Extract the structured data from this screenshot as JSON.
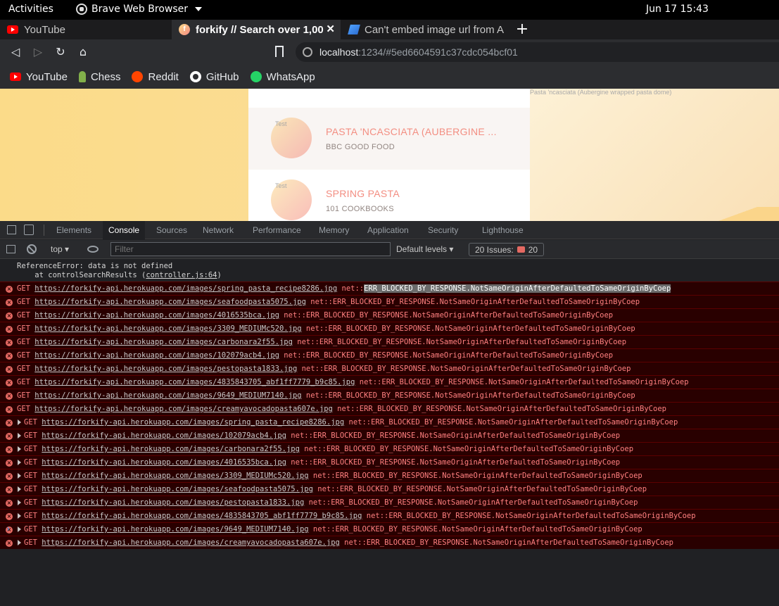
{
  "topbar": {
    "activities": "Activities",
    "app_name": "Brave Web Browser",
    "clock": "Jun 17  15:43"
  },
  "tabs": [
    {
      "title": "YouTube",
      "icon": "youtube-icon"
    },
    {
      "title": "forkify // Search over 1,00",
      "icon": "forkify-icon"
    },
    {
      "title": "Can't embed image url from A",
      "icon": "codesandbox-icon"
    }
  ],
  "toolbar": {
    "url_host": "localhost",
    "url_rest": ":1234/#5ed6604591c37cdc054bcf01"
  },
  "bookmarks": [
    {
      "label": "YouTube",
      "icon": "youtube-icon"
    },
    {
      "label": "Chess",
      "icon": "chess-icon"
    },
    {
      "label": "Reddit",
      "icon": "reddit-icon"
    },
    {
      "label": "GitHub",
      "icon": "github-icon"
    },
    {
      "label": "WhatsApp",
      "icon": "whatsapp-icon"
    }
  ],
  "page": {
    "recipe_image_alt": "Pasta 'ncasciata (Aubergine wrapped pasta dome)",
    "results": [
      {
        "title": "PASTA 'NCASCIATA (AUBERGINE ...",
        "publisher": "BBC GOOD FOOD",
        "img_alt": "Test",
        "active": true
      },
      {
        "title": "SPRING PASTA",
        "publisher": "101 COOKBOOKS",
        "img_alt": "Test",
        "active": false
      }
    ]
  },
  "devtools": {
    "tabs": [
      "Elements",
      "Console",
      "Sources",
      "Network",
      "Performance",
      "Memory",
      "Application",
      "Security",
      "Lighthouse"
    ],
    "active_tab": "Console",
    "context": "top",
    "filter_placeholder": "Filter",
    "levels": "Default levels",
    "issues_label": "20 Issues:",
    "issues_count": "20",
    "ref_error_line1": "ReferenceError: data is not defined",
    "ref_error_line2_prefix": "    at controlSearchResults (",
    "ref_error_link": "controller.js:64",
    "ref_error_line2_suffix": ")",
    "colors": {
      "error_bg": "#290000",
      "error_text": "#ff8080",
      "error_border": "#5c0000"
    },
    "error_suffix": "net::ERR_BLOCKED_BY_RESPONSE.NotSameOriginAfterDefaultedToSameOriginByCoep",
    "errors": [
      {
        "url": "https://forkify-api.herokuapp.com/images/spring_pasta_recipe8286.jpg",
        "expandable": false,
        "highlight": true
      },
      {
        "url": "https://forkify-api.herokuapp.com/images/seafoodpasta5075.jpg",
        "expandable": false
      },
      {
        "url": "https://forkify-api.herokuapp.com/images/4016535bca.jpg",
        "expandable": false
      },
      {
        "url": "https://forkify-api.herokuapp.com/images/3309_MEDIUMc520.jpg",
        "expandable": false
      },
      {
        "url": "https://forkify-api.herokuapp.com/images/carbonara2f55.jpg",
        "expandable": false
      },
      {
        "url": "https://forkify-api.herokuapp.com/images/102079acb4.jpg",
        "expandable": false
      },
      {
        "url": "https://forkify-api.herokuapp.com/images/pestopasta1833.jpg",
        "expandable": false
      },
      {
        "url": "https://forkify-api.herokuapp.com/images/4835843705_abf1ff7779_b9c85.jpg",
        "expandable": false
      },
      {
        "url": "https://forkify-api.herokuapp.com/images/9649_MEDIUM7140.jpg",
        "expandable": false
      },
      {
        "url": "https://forkify-api.herokuapp.com/images/creamyavocadopasta607e.jpg",
        "expandable": false
      },
      {
        "url": "https://forkify-api.herokuapp.com/images/spring_pasta_recipe8286.jpg",
        "expandable": true
      },
      {
        "url": "https://forkify-api.herokuapp.com/images/102079acb4.jpg",
        "expandable": true
      },
      {
        "url": "https://forkify-api.herokuapp.com/images/carbonara2f55.jpg",
        "expandable": true
      },
      {
        "url": "https://forkify-api.herokuapp.com/images/4016535bca.jpg",
        "expandable": true
      },
      {
        "url": "https://forkify-api.herokuapp.com/images/3309_MEDIUMc520.jpg",
        "expandable": true
      },
      {
        "url": "https://forkify-api.herokuapp.com/images/seafoodpasta5075.jpg",
        "expandable": true
      },
      {
        "url": "https://forkify-api.herokuapp.com/images/pestopasta1833.jpg",
        "expandable": true
      },
      {
        "url": "https://forkify-api.herokuapp.com/images/4835843705_abf1ff7779_b9c85.jpg",
        "expandable": true
      },
      {
        "url": "https://forkify-api.herokuapp.com/images/9649_MEDIUM7140.jpg",
        "expandable": true
      },
      {
        "url": "https://forkify-api.herokuapp.com/images/creamyavocadopasta607e.jpg",
        "expandable": true
      }
    ]
  }
}
